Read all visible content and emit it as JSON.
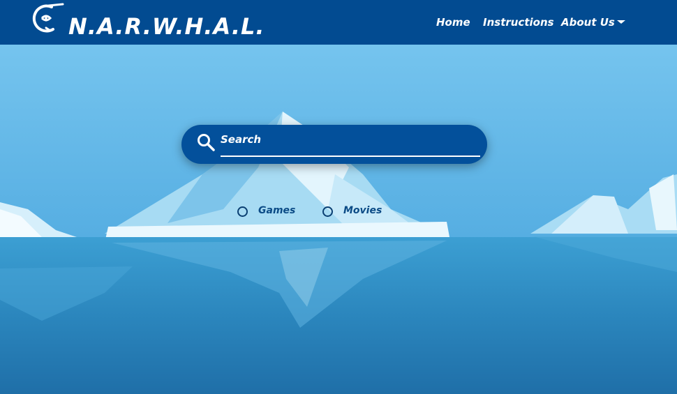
{
  "app": {
    "brand": "N.A.R.W.H.A.L."
  },
  "nav": {
    "home": "Home",
    "instructions": "Instructions",
    "about": "About Us"
  },
  "search": {
    "placeholder": "Search"
  },
  "filters": [
    {
      "label": "Games"
    },
    {
      "label": "Movies"
    }
  ],
  "colors": {
    "navbar": "#024b91",
    "search_box": "#03509b",
    "sky": "#5fb6e6",
    "water": "#2f8fc4"
  }
}
